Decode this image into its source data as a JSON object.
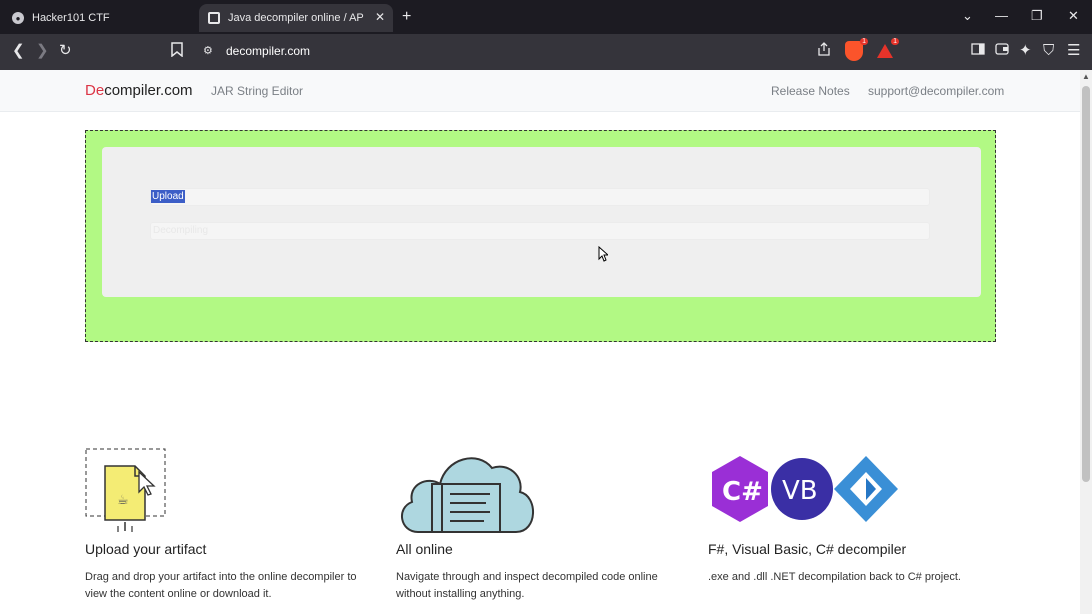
{
  "browser": {
    "tabs": [
      {
        "title": "Hacker101 CTF",
        "active": false
      },
      {
        "title": "Java decompiler online / APK decompiler",
        "active": true
      }
    ],
    "url": "decompiler.com",
    "brave_shield_count": "1",
    "rewards_count": "1"
  },
  "site": {
    "brand_prefix": "De",
    "brand_rest": "compiler.com",
    "nav_left": [
      "JAR String Editor"
    ],
    "nav_right": [
      "Release Notes",
      "support@decompiler.com"
    ]
  },
  "upload": {
    "selected_text": "Upload",
    "upload_ghost": "",
    "decompile_ghost": "Decompiling"
  },
  "features": [
    {
      "heading": "Upload your artifact",
      "text": "Drag and drop your artifact into the online decompiler to view the content online or download it.",
      "icon": "upload-file-icon"
    },
    {
      "heading": "All online",
      "text": "Navigate through and inspect decompiled code online without installing anything.",
      "icon": "cloud-code-icon"
    },
    {
      "heading": "F#, Visual Basic, C# decompiler",
      "text": ".exe and .dll .NET decompilation back to C# project.",
      "icon": "dotnet-languages-icon"
    }
  ],
  "colors": {
    "brand_red": "#dc3545",
    "dropzone": "#b2f984",
    "selection": "#3c5ec7"
  }
}
